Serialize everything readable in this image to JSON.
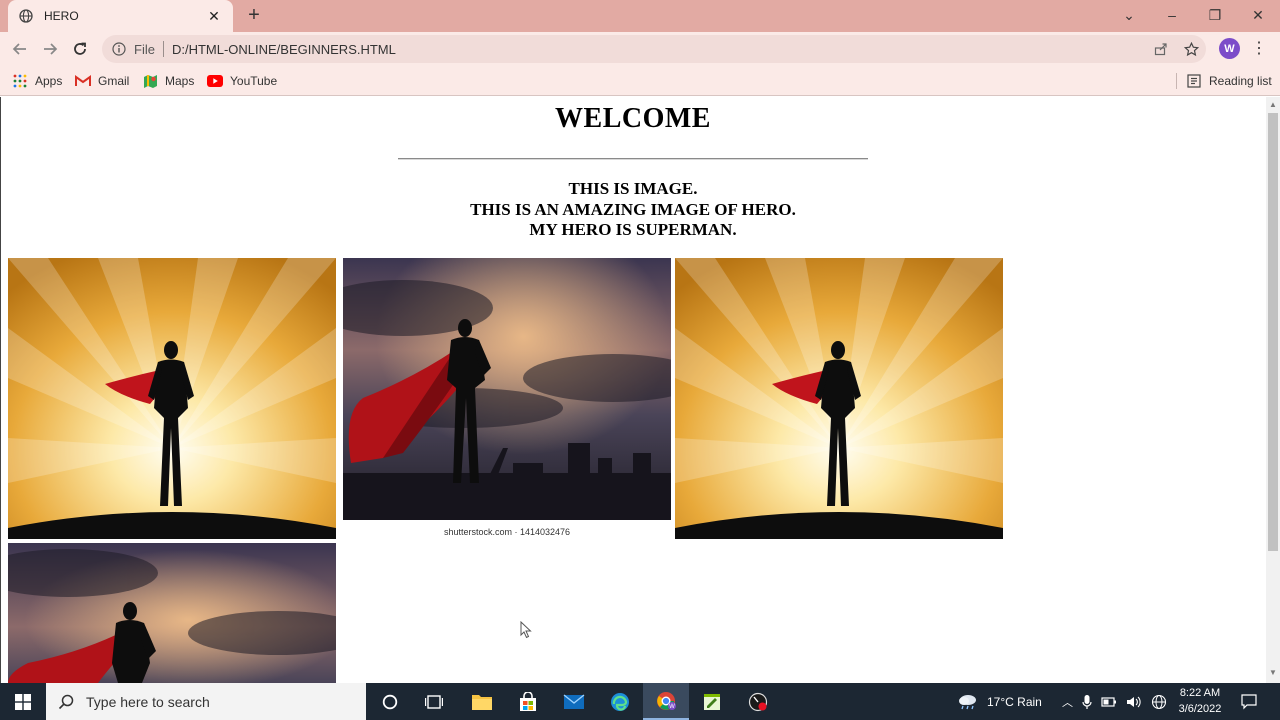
{
  "browser": {
    "tab_title": "HERO",
    "tab_close": "✕",
    "new_tab": "+",
    "address": {
      "scheme": "File",
      "url": "D:/HTML-ONLINE/BEGINNERS.HTML"
    },
    "profile_initial": "W",
    "menu": "⋮",
    "window_controls": {
      "dropdown": "⌄",
      "minimize": "–",
      "restore": "❐",
      "close": "✕"
    },
    "bookmarks": [
      {
        "label": "Apps",
        "icon": "apps-grid-icon"
      },
      {
        "label": "Gmail",
        "icon": "gmail-icon"
      },
      {
        "label": "Maps",
        "icon": "maps-icon"
      },
      {
        "label": "YouTube",
        "icon": "youtube-icon"
      }
    ],
    "reading_list": "Reading list"
  },
  "page": {
    "heading": "WELCOME",
    "lines": [
      "THIS IS IMAGE.",
      "THIS IS AN AMAZING IMAGE OF HERO.",
      "MY HERO IS SUPERMAN."
    ],
    "images": [
      {
        "kind": "sunburst-hero"
      },
      {
        "kind": "cloudy-hero",
        "caption": "shutterstock.com · 1414032476"
      },
      {
        "kind": "sunburst-hero"
      },
      {
        "kind": "cloudy-hero"
      }
    ],
    "colors": {
      "sunburst_center": "#fff8e0",
      "sunburst_edge": "#c98b1a",
      "cape": "#c0141c",
      "silhouette": "#0d0d0d",
      "sky_dark": "#2a2433",
      "sky_glow": "#d9a06a"
    }
  },
  "taskbar": {
    "search_placeholder": "Type here to search",
    "weather": "17°C  Rain",
    "time": "8:22 AM",
    "date": "3/6/2022"
  }
}
